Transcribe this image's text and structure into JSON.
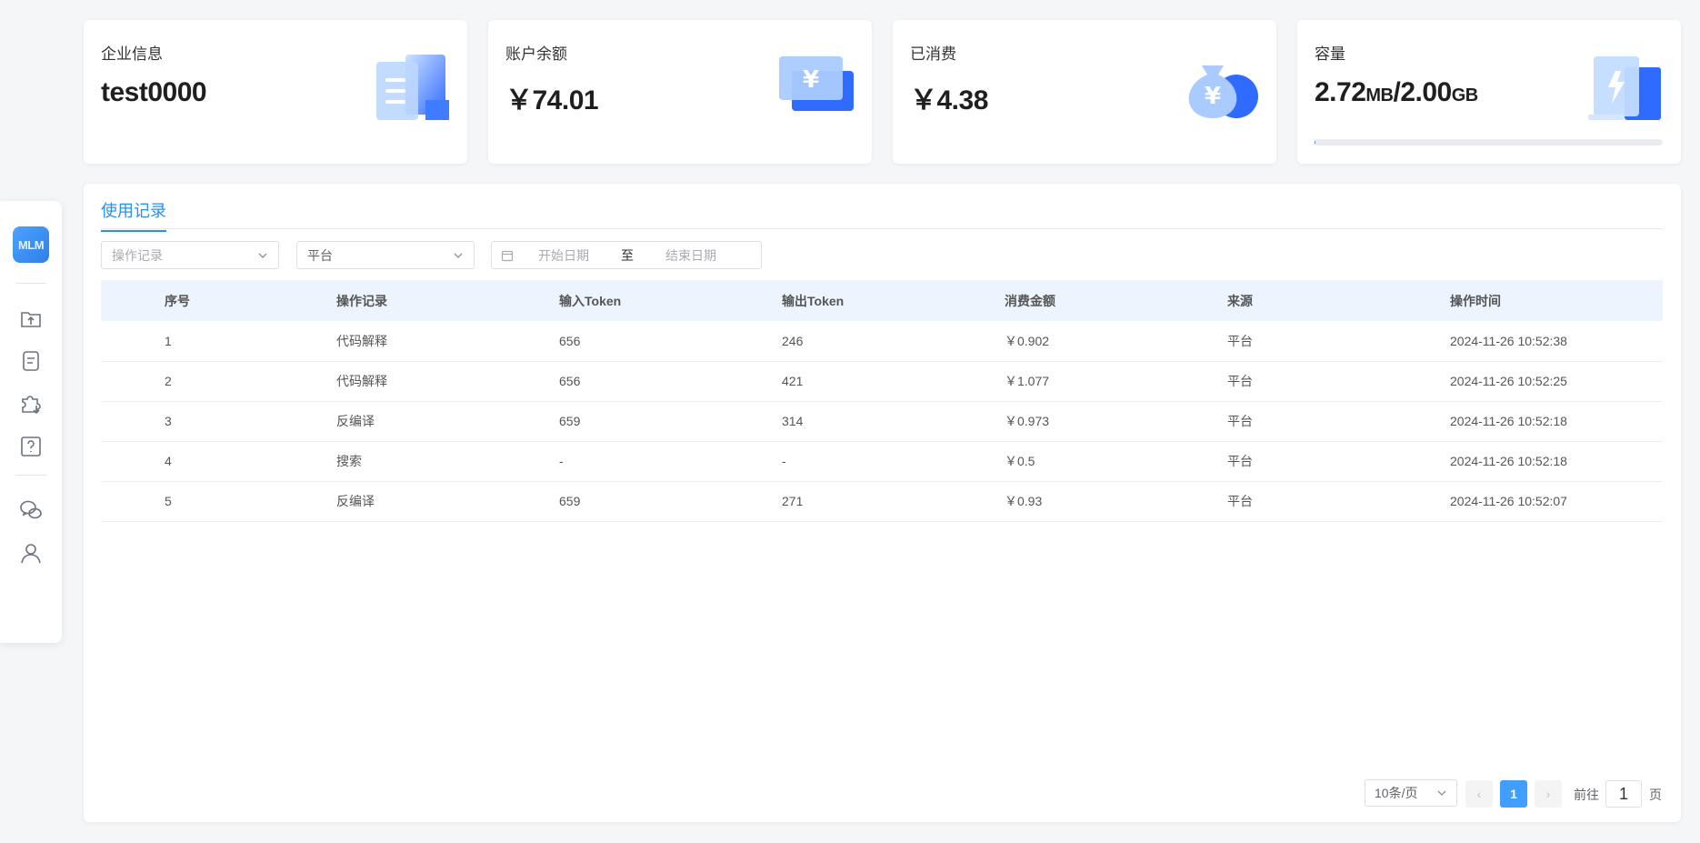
{
  "sidebar": {
    "logo_text": "MLM",
    "icons": [
      "folder-upload-icon",
      "document-icon",
      "puzzle-download-icon",
      "help-question-icon",
      "wechat-icon",
      "user-icon"
    ]
  },
  "cards": [
    {
      "label": "企业信息",
      "value": "test0000",
      "illustration": "building-icon"
    },
    {
      "label": "账户余额",
      "value": "￥74.01",
      "illustration": "yen-card-icon"
    },
    {
      "label": "已消费",
      "value": "￥4.38",
      "illustration": "money-bag-icon"
    },
    {
      "label": "容量",
      "value_used": "2.72",
      "unit_used": "MB",
      "slash": "/",
      "value_total": "2.00",
      "unit_total": "GB",
      "usage_fraction": 0.0013,
      "illustration": "storage-icon"
    }
  ],
  "colors": {
    "accent": "#2b8ef0",
    "page_active": "#409eff",
    "header_bg": "#ecf4fe"
  },
  "tabs": [
    {
      "label": "使用记录",
      "active": true
    }
  ],
  "filters": {
    "operation": {
      "placeholder": "操作记录"
    },
    "platform": {
      "value": "平台"
    },
    "date": {
      "start_placeholder": "开始日期",
      "separator": "至",
      "end_placeholder": "结束日期"
    }
  },
  "table": {
    "columns": [
      "序号",
      "操作记录",
      "输入Token",
      "输出Token",
      "消费金额",
      "来源",
      "操作时间"
    ],
    "rows": [
      [
        "1",
        "代码解释",
        "656",
        "246",
        "￥0.902",
        "平台",
        "2024-11-26 10:52:38"
      ],
      [
        "2",
        "代码解释",
        "656",
        "421",
        "￥1.077",
        "平台",
        "2024-11-26 10:52:25"
      ],
      [
        "3",
        "反编译",
        "659",
        "314",
        "￥0.973",
        "平台",
        "2024-11-26 10:52:18"
      ],
      [
        "4",
        "搜索",
        "-",
        "-",
        "￥0.5",
        "平台",
        "2024-11-26 10:52:18"
      ],
      [
        "5",
        "反编译",
        "659",
        "271",
        "￥0.93",
        "平台",
        "2024-11-26 10:52:07"
      ]
    ]
  },
  "pagination": {
    "page_size": "10条/页",
    "prev": "‹",
    "next": "›",
    "current_page": "1",
    "goto_prefix": "前往",
    "goto_value": "1",
    "goto_suffix": "页"
  }
}
